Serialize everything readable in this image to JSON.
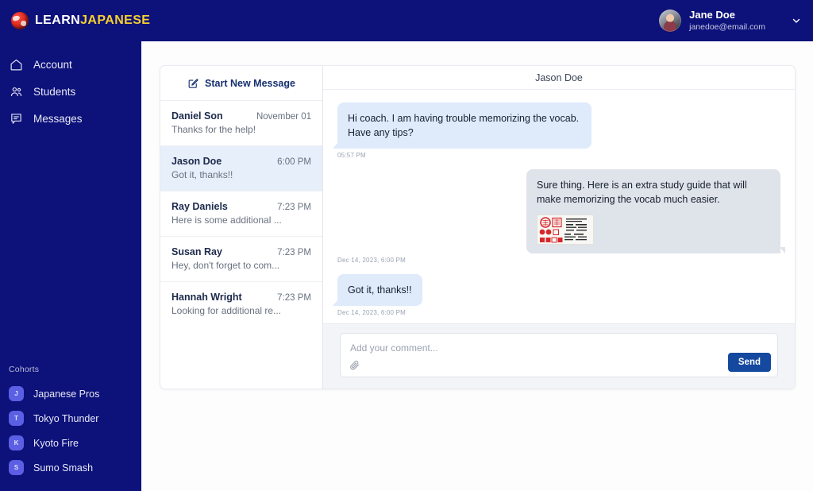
{
  "brand": {
    "word1": "LEARN",
    "word2": "JAPANESE",
    "logo_icon": "globe-icon"
  },
  "sidebar": {
    "nav": [
      {
        "label": "Account",
        "icon": "home-icon"
      },
      {
        "label": "Students",
        "icon": "users-icon"
      },
      {
        "label": "Messages",
        "icon": "chat-bubble-icon"
      }
    ],
    "cohorts_label": "Cohorts",
    "cohorts": [
      {
        "initial": "J",
        "label": "Japanese Pros"
      },
      {
        "initial": "T",
        "label": "Tokyo Thunder"
      },
      {
        "initial": "K",
        "label": "Kyoto Fire"
      },
      {
        "initial": "S",
        "label": "Sumo Smash"
      }
    ]
  },
  "topbar": {
    "user_name": "Jane Doe",
    "user_email": "janedoe@email.com",
    "avatar_icon": "avatar",
    "chevron_icon": "chevron-down-icon"
  },
  "message_list": {
    "new_message_label": "Start New Message",
    "new_message_icon": "compose-pencil-icon",
    "conversations": [
      {
        "name": "Daniel Son",
        "time": "November 01",
        "preview": "Thanks for the help!",
        "active": false
      },
      {
        "name": "Jason Doe",
        "time": "6:00 PM",
        "preview": "Got it, thanks!!",
        "active": true
      },
      {
        "name": "Ray Daniels",
        "time": "7:23 PM",
        "preview": "Here is some additional ...",
        "active": false
      },
      {
        "name": "Susan Ray",
        "time": "7:23 PM",
        "preview": "Hey, don't forget to com...",
        "active": false
      },
      {
        "name": "Hannah Wright",
        "time": "7:23 PM",
        "preview": "Looking for additional re...",
        "active": false
      }
    ]
  },
  "chat": {
    "title": "Jason Doe",
    "messages": [
      {
        "direction": "in",
        "text": "Hi coach. I am having trouble memorizing the vocab. Have any tips?",
        "timestamp": "05:57 PM",
        "attachment": null
      },
      {
        "direction": "out",
        "text": "Sure thing. Here is an extra study guide that will make memorizing the vocab much easier.",
        "timestamp": "Dec 14, 2023, 6:00 PM",
        "attachment": "japanese-study-guide-thumbnail"
      },
      {
        "direction": "in",
        "text": "Got it, thanks!!",
        "timestamp": "Dec 14, 2023, 6:00 PM",
        "attachment": null
      }
    ]
  },
  "composer": {
    "placeholder": "Add your comment...",
    "value": "",
    "attach_icon": "paperclip-icon",
    "send_label": "Send"
  },
  "colors": {
    "navy": "#0d117a",
    "accent_yellow": "#f6d02f",
    "send_blue": "#14499f",
    "bubble_in": "#dfeafb",
    "bubble_out": "#dfe3ea",
    "active_row": "#e7effb",
    "cohort_badge": "#5b5fe3"
  }
}
